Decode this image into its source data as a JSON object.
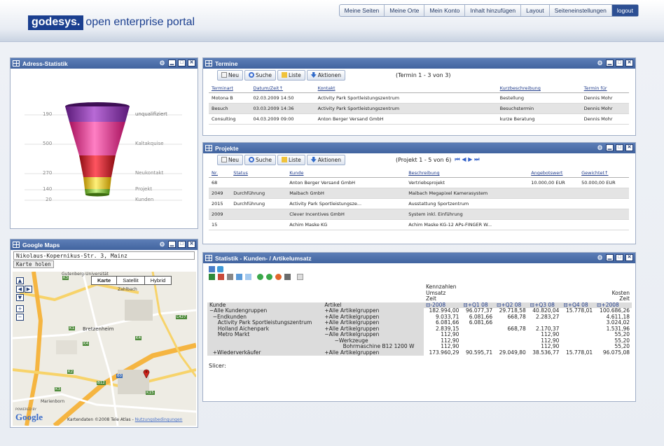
{
  "brand": {
    "logo": "godesys.",
    "tagline": "open enterprise portal"
  },
  "topnav": [
    "Meine Seiten",
    "Meine Orte",
    "Mein Konto",
    "Inhalt hinzufügen",
    "Layout",
    "Seiteneinstellungen"
  ],
  "logout": "logout",
  "adress": {
    "title": "Adress-Statistik",
    "rows": [
      {
        "value": "190",
        "label": "unqualifiziert",
        "color": "#8a2fa3"
      },
      {
        "value": "500",
        "label": "Kaltakquise",
        "color": "#e0398f"
      },
      {
        "value": "270",
        "label": "Neukontakt",
        "color": "#d3202a"
      },
      {
        "value": "140",
        "label": "Projekt",
        "color": "#f2c200"
      },
      {
        "value": "20",
        "label": "Kunden",
        "color": "#7ec33a"
      }
    ]
  },
  "maps": {
    "title": "Google Maps",
    "address": "Nikolaus-Kopernikus-Str. 3, Mainz",
    "button": "Karte holen",
    "types": [
      "Karte",
      "Satellit",
      "Hybrid"
    ],
    "places": [
      "Gutenberg-Universität",
      "Zahlbach",
      "Bretzenheim",
      "Marienborn"
    ],
    "roads": [
      "K3",
      "L427",
      "K1",
      "K4",
      "K2",
      "K3",
      "B12",
      "60",
      "K15",
      "K4"
    ],
    "powered": "POWERED BY",
    "google": "Google",
    "credits": "Kartendaten ©2008 Tele Atlas - ",
    "terms": "Nutzungsbedingungen"
  },
  "termine": {
    "title": "Termine",
    "buttons": [
      "Neu",
      "Suche",
      "Liste",
      "Aktionen"
    ],
    "info": "(Termin 1 - 3 von 3)",
    "headers": [
      "Terminart",
      "Datum/Zeit↑",
      "Kontakt",
      "Kurzbeschreibung",
      "Termin für"
    ],
    "rows": [
      [
        "Motona B",
        "02.03.2009 14:50",
        "Activity Park Sportleistungszentrum",
        "Bestellung",
        "Dennis Mohr"
      ],
      [
        "Besuch",
        "03.03.2009 14:36",
        "Activity Park Sportleistungszentrum",
        "Besuchstermin",
        "Dennis Mohr"
      ],
      [
        "Consulting",
        "04.03.2009 09:00",
        "Anton Berger Versand GmbH",
        "kurze Beratung",
        "Dennis Mohr"
      ]
    ]
  },
  "projekte": {
    "title": "Projekte",
    "buttons": [
      "Neu",
      "Suche",
      "Liste",
      "Aktionen"
    ],
    "info": "(Projekt 1 - 5 von 6)",
    "pager": "⏮ ◀ ▶ ⏭",
    "headers": [
      "Nr.",
      "Status",
      "Kunde",
      "Beschreibung",
      "Angebotswert",
      "Gewichtet↑"
    ],
    "rows": [
      [
        "68",
        "",
        "Anton Berger Versand GmbH",
        "Vertriebsprojekt",
        "10.000,00 EUR",
        "50.000,00 EUR"
      ],
      [
        "2049",
        "Durchführung",
        "Maibach GmbH",
        "Maibach Megapixel Kamerasystem",
        "",
        ""
      ],
      [
        "2015",
        "Durchführung",
        "Activity Park Sportleistungsze...",
        "Ausstattung Sportzentrum",
        "",
        ""
      ],
      [
        "2009",
        "",
        "Clever Incentives GmbH",
        "System inkl. Einführung",
        "",
        ""
      ],
      [
        "15",
        "",
        "Achim Maske KG",
        "Achim Maske KG-12 APs-FINGER W...",
        "",
        ""
      ]
    ]
  },
  "statistik": {
    "title": "Statistik - Kunden- / Artikelumsatz",
    "col_kennzahlen": "Kennzahlen",
    "col_umsatz": "Umsatz",
    "col_zeit": "Zeit",
    "col_kosten": "Kosten",
    "col_zeit2": "Zeit",
    "h_kunde": "Kunde",
    "h_artikel": "Artikel",
    "periods": [
      "⊟-2008",
      "⊟+Q1 08",
      "⊟+Q2 08",
      "⊟+Q3 08",
      "⊟+Q4 08",
      "⊟+2008"
    ],
    "rows": [
      {
        "k": "−Alle Kundengruppen",
        "a": "+Alle Artikelgruppen",
        "v": [
          "182.994,00",
          "96.077,37",
          "29.718,58",
          "40.820,04",
          "15.778,01",
          "100.686,26"
        ]
      },
      {
        "k": "  −Endkunden",
        "a": "+Alle Artikelgruppen",
        "v": [
          "9.033,71",
          "6.081,66",
          "668,78",
          "2.283,27",
          "",
          "4.611,18"
        ]
      },
      {
        "k": "     Activity Park Sportleistungszentrum",
        "a": "+Alle Artikelgruppen",
        "v": [
          "6.081,66",
          "6.081,66",
          "",
          "",
          "",
          "3.024,02"
        ]
      },
      {
        "k": "     Holland Aichenpark",
        "a": "+Alle Artikelgruppen",
        "v": [
          "2.839,15",
          "",
          "668,78",
          "2.170,37",
          "",
          "1.531,96"
        ]
      },
      {
        "k": "     Metro Markt",
        "a": "−Alle Artikelgruppen",
        "v": [
          "112,90",
          "",
          "",
          "112,90",
          "",
          "55,20"
        ]
      },
      {
        "k": "",
        "a": "      −Werkzeuge",
        "v": [
          "112,90",
          "",
          "",
          "112,90",
          "",
          "55,20"
        ]
      },
      {
        "k": "",
        "a": "           Bohrmaschine B12 1200 W",
        "v": [
          "112,90",
          "",
          "",
          "112,90",
          "",
          "55,20"
        ]
      },
      {
        "k": "  +Wiederverkäufer",
        "a": "+Alle Artikelgruppen",
        "v": [
          "173.960,29",
          "90.595,71",
          "29.049,80",
          "38.536,77",
          "15.778,01",
          "96.075,08"
        ]
      }
    ],
    "slicer": "Slicer:"
  }
}
